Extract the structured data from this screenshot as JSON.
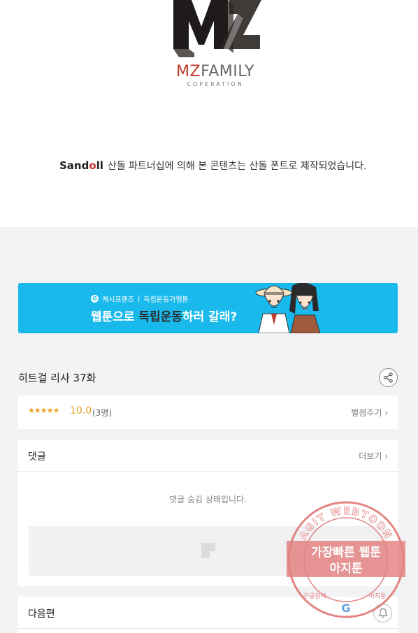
{
  "header": {
    "logo": {
      "mark": "MZ",
      "brand_mz": "MZ",
      "brand_rest": "FAMILY",
      "sub": "COPERATION"
    },
    "sandoll": {
      "brand_main": "Sand",
      "brand_red": "o",
      "brand_end": "ll",
      "notice": "산돌 파트너십에 의해 본 콘텐츠는 산돌 폰트로 제작되었습니다."
    }
  },
  "banner": {
    "tag_left": "캐시프렌즈",
    "tag_right": "독립운동가웹툰",
    "title_prefix": "웹툰으로 ",
    "title_highlight": "독립운동",
    "title_suffix": "하러 갈래?",
    "g_badge": "G"
  },
  "episode": {
    "title": "히트걸 리사 37화"
  },
  "rating": {
    "stars": "★★★★★",
    "score": "10.0",
    "count": "(3명)",
    "rate_label": "별점주기 ›"
  },
  "comments": {
    "header": "댓글",
    "more_label": "더보기 ›",
    "hidden_message": "댓글 숨김 상태입니다."
  },
  "next": {
    "label": "다음편"
  },
  "watermark": {
    "ring_text": "AGIT WEBTOON",
    "line1": "가장빠른 웹툰",
    "line2": "아지툰",
    "bottom_left": "구글검색",
    "bottom_right": "아지툰",
    "g": "G"
  },
  "colors": {
    "banner_bg": "#1ab9ec",
    "star": "#f0a020",
    "watermark": "#e06060",
    "brand_red": "#d0312d"
  },
  "icons": [
    "mz-logo-icon",
    "share-icon",
    "bell-icon",
    "image-placeholder-icon",
    "google-icon"
  ]
}
